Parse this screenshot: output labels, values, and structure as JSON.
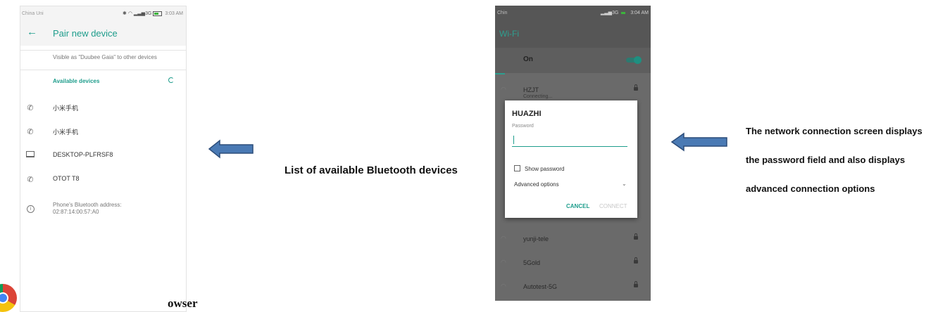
{
  "bluetooth_screen": {
    "status_bar": {
      "carrier": "China Uni",
      "time": "3:03 AM",
      "network": "3G"
    },
    "title": "Pair new device",
    "visible_as": "Visible as \"Duubee Gaia\" to other devices",
    "section_header": "Available devices",
    "devices": [
      {
        "name": "小米手机",
        "icon": "phone-icon"
      },
      {
        "name": "小米手机",
        "icon": "phone-icon"
      },
      {
        "name": "DESKTOP-PLFRSF8",
        "icon": "laptop-icon"
      },
      {
        "name": "OTOT T8",
        "icon": "phone-icon"
      }
    ],
    "address_label": "Phone's Bluetooth address:",
    "address_value": "02:87:14:00:57:A0",
    "accent_color": "#1e9d8c"
  },
  "caption_bluetooth": "List of available Bluetooth devices",
  "chrome_fragment": {
    "text": "owser"
  },
  "wifi_screen": {
    "status_bar": {
      "carrier": "Chin",
      "time": "3:04 AM",
      "network": "3G"
    },
    "title": "Wi-Fi",
    "toggle_label": "On",
    "toggle_on": true,
    "networks": [
      {
        "name": "HZJT",
        "status": "Connecting..."
      },
      {
        "name": "yunji-tele"
      },
      {
        "name": "5Gold"
      },
      {
        "name": "Autotest-5G"
      }
    ],
    "dialog": {
      "title": "HUAZHI",
      "password_label": "Password",
      "password_value": "",
      "show_password_label": "Show password",
      "advanced_label": "Advanced options",
      "cancel_label": "CANCEL",
      "connect_label": "CONNECT"
    }
  },
  "caption_wifi": "The network connection screen displays the password field and also displays advanced connection options",
  "colors": {
    "arrow_fill": "#4a7ab4",
    "arrow_stroke": "#2c4d7a"
  }
}
